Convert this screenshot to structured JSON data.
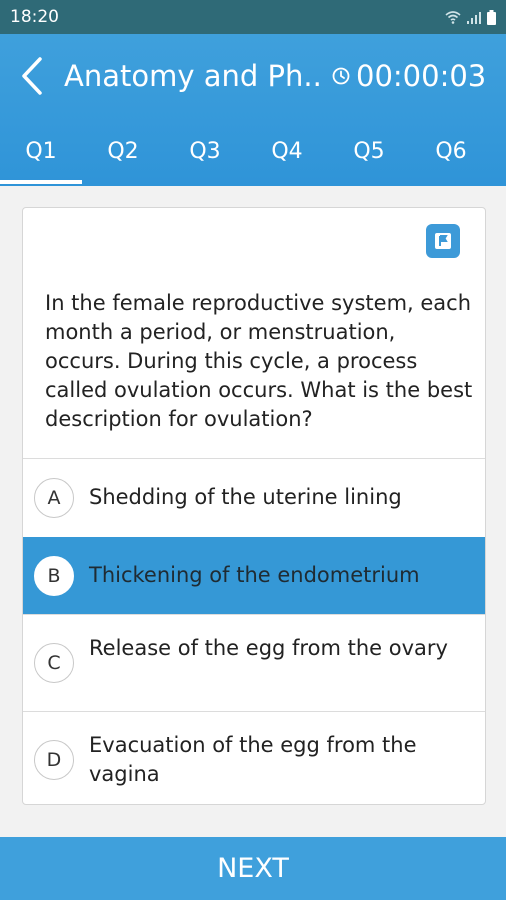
{
  "status_bar": {
    "time": "18:20",
    "icons": [
      "wifi-icon",
      "signal-icon",
      "battery-icon"
    ]
  },
  "header": {
    "back_icon": "chevron-left-icon",
    "title": "Anatomy and Ph...",
    "timer_icon": "clock-icon",
    "timer": "00:00:03"
  },
  "tabs": [
    {
      "label": "Q1",
      "active": true
    },
    {
      "label": "Q2",
      "active": false
    },
    {
      "label": "Q3",
      "active": false
    },
    {
      "label": "Q4",
      "active": false
    },
    {
      "label": "Q5",
      "active": false
    },
    {
      "label": "Q6",
      "active": false
    }
  ],
  "question": {
    "flag_icon": "flag-icon",
    "text": "In the female reproductive system, each month a period, or menstruation, occurs.  During this cycle, a process called ovulation occurs.  What is the best description for ovulation?"
  },
  "options": [
    {
      "letter": "A",
      "text": "Shedding of the uterine lining",
      "selected": false
    },
    {
      "letter": "B",
      "text": "Thickening of the endometrium",
      "selected": true
    },
    {
      "letter": "C",
      "text": "Release of the egg from the ovary",
      "selected": false
    },
    {
      "letter": "D",
      "text": "Evacuation of the egg from the vagina",
      "selected": false
    }
  ],
  "footer": {
    "next_label": "NEXT"
  },
  "colors": {
    "status_bar": "#2f6a77",
    "header": "#3fa0dc",
    "selected_option": "#3598d6",
    "flag": "#3d9ad8"
  }
}
